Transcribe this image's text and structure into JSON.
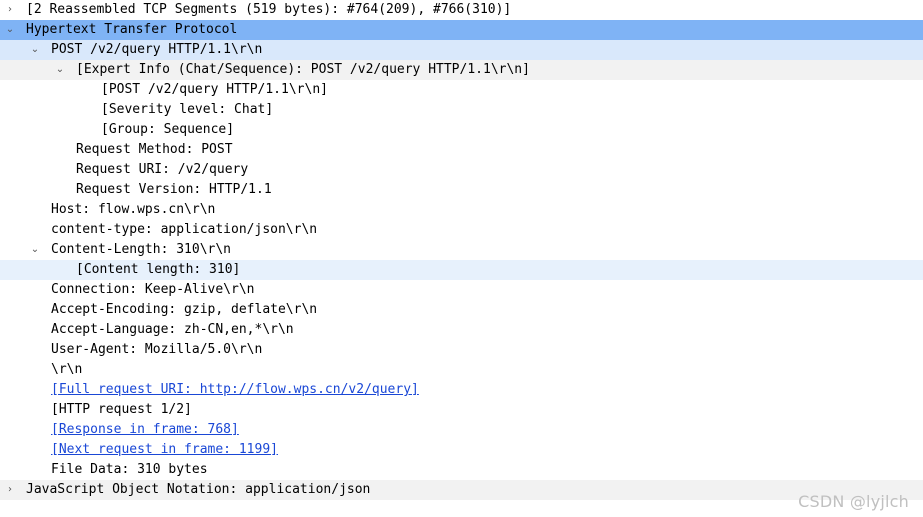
{
  "tree": {
    "rows": [
      {
        "text": "[2 Reassembled TCP Segments (519 bytes): #764(209), #766(310)]",
        "level": 0,
        "expander": "›",
        "style": "",
        "link": false
      },
      {
        "text": "Hypertext Transfer Protocol",
        "level": 0,
        "expander": "⌄",
        "style": "selected",
        "link": false
      },
      {
        "text": "POST /v2/query HTTP/1.1\\r\\n",
        "level": 1,
        "expander": "⌄",
        "style": "selected-parent",
        "link": false
      },
      {
        "text": "[Expert Info (Chat/Sequence): POST /v2/query HTTP/1.1\\r\\n]",
        "level": 2,
        "expander": "⌄",
        "style": "altbg",
        "link": false
      },
      {
        "text": "[POST /v2/query HTTP/1.1\\r\\n]",
        "level": 3,
        "expander": "",
        "style": "",
        "link": false
      },
      {
        "text": "[Severity level: Chat]",
        "level": 3,
        "expander": "",
        "style": "",
        "link": false
      },
      {
        "text": "[Group: Sequence]",
        "level": 3,
        "expander": "",
        "style": "",
        "link": false
      },
      {
        "text": "Request Method: POST",
        "level": 2,
        "expander": "",
        "style": "",
        "link": false
      },
      {
        "text": "Request URI: /v2/query",
        "level": 2,
        "expander": "",
        "style": "",
        "link": false
      },
      {
        "text": "Request Version: HTTP/1.1",
        "level": 2,
        "expander": "",
        "style": "",
        "link": false
      },
      {
        "text": "Host: flow.wps.cn\\r\\n",
        "level": 1,
        "expander": "",
        "style": "",
        "link": false
      },
      {
        "text": "content-type: application/json\\r\\n",
        "level": 1,
        "expander": "",
        "style": "",
        "link": false
      },
      {
        "text": "Content-Length: 310\\r\\n",
        "level": 1,
        "expander": "⌄",
        "style": "",
        "link": false
      },
      {
        "text": "[Content length: 310]",
        "level": 2,
        "expander": "",
        "style": "hover",
        "link": false
      },
      {
        "text": "Connection: Keep-Alive\\r\\n",
        "level": 1,
        "expander": "",
        "style": "",
        "link": false
      },
      {
        "text": "Accept-Encoding: gzip, deflate\\r\\n",
        "level": 1,
        "expander": "",
        "style": "",
        "link": false
      },
      {
        "text": "Accept-Language: zh-CN,en,*\\r\\n",
        "level": 1,
        "expander": "",
        "style": "",
        "link": false
      },
      {
        "text": "User-Agent: Mozilla/5.0\\r\\n",
        "level": 1,
        "expander": "",
        "style": "",
        "link": false
      },
      {
        "text": "\\r\\n",
        "level": 1,
        "expander": "",
        "style": "",
        "link": false
      },
      {
        "text": "[Full request URI: http://flow.wps.cn/v2/query]",
        "level": 1,
        "expander": "",
        "style": "",
        "link": true
      },
      {
        "text": "[HTTP request 1/2]",
        "level": 1,
        "expander": "",
        "style": "",
        "link": false
      },
      {
        "text": "[Response in frame: 768]",
        "level": 1,
        "expander": "",
        "style": "",
        "link": true
      },
      {
        "text": "[Next request in frame: 1199]",
        "level": 1,
        "expander": "",
        "style": "",
        "link": true
      },
      {
        "text": "File Data: 310 bytes",
        "level": 1,
        "expander": "",
        "style": "",
        "link": false
      },
      {
        "text": "JavaScript Object Notation: application/json",
        "level": 0,
        "expander": "›",
        "style": "altbg",
        "link": false
      }
    ]
  },
  "watermark": "CSDN @lyjlch",
  "colors": {
    "selected": "#7fb3f5",
    "link": "#1a47d6"
  }
}
